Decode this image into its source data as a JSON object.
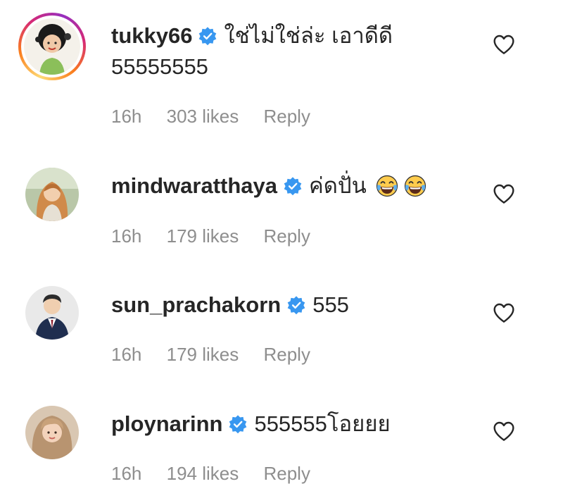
{
  "comments": [
    {
      "username": "tukky66",
      "text": "ใช่ไม่ใช่ล่ะ เอาดีดี",
      "text_line2": "55555555",
      "time": "16h",
      "likes": "303 likes",
      "reply": "Reply",
      "emojis": []
    },
    {
      "username": "mindwaratthaya",
      "text": "ค่ดปั่น",
      "time": "16h",
      "likes": "179 likes",
      "reply": "Reply",
      "emojis": [
        "face-with-tears-of-joy",
        "face-with-tears-of-joy"
      ]
    },
    {
      "username": "sun_prachakorn",
      "text": "555",
      "time": "16h",
      "likes": "179 likes",
      "reply": "Reply",
      "emojis": []
    },
    {
      "username": "ploynarinn",
      "text": "555555โอยยย",
      "time": "16h",
      "likes": "194 likes",
      "reply": "Reply",
      "emojis": []
    }
  ],
  "colors": {
    "text": "#262626",
    "meta": "#8e8e8e",
    "verified": "#3897f0",
    "story_ring": [
      "#feda75",
      "#fa7e1e",
      "#d62976",
      "#962fbf"
    ]
  },
  "icons": {
    "verified": "verified-badge-icon",
    "like": "heart-outline-icon"
  }
}
